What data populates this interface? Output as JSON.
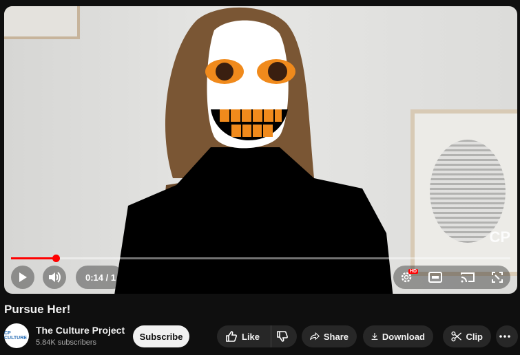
{
  "window": {
    "theme": "dark",
    "accent": "#ff0000"
  },
  "player": {
    "time_display": "0:14 / 1",
    "progress_fraction": 0.09,
    "watermark": "CP",
    "controls": {
      "play_icon": "play-icon",
      "volume_icon": "volume-icon",
      "settings_icon": "gear-icon",
      "hd_badge": "HD",
      "theater_icon": "theater-mode-icon",
      "cast_icon": "cast-icon",
      "fullscreen_icon": "fullscreen-icon"
    }
  },
  "video": {
    "title": "Pursue Her!"
  },
  "channel": {
    "name": "The Culture Project",
    "subscribers": "5.84K subscribers",
    "avatar_text": "CP CULTURE"
  },
  "actions": {
    "subscribe": "Subscribe",
    "like": "Like",
    "share": "Share",
    "download": "Download",
    "clip": "Clip",
    "more_icon": "more-horizontal-icon"
  }
}
